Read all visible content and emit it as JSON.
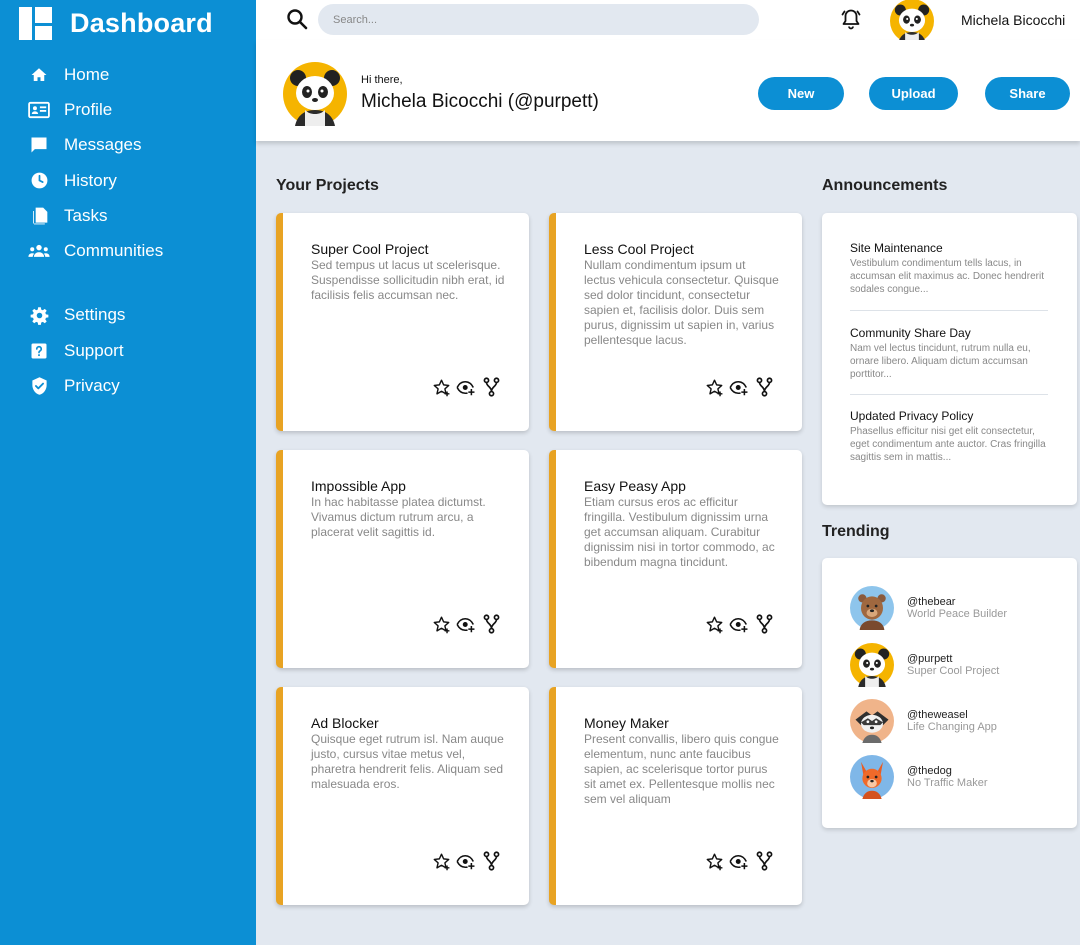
{
  "sidebar": {
    "title": "Dashboard",
    "nav": [
      {
        "label": "Home",
        "icon": "home-icon"
      },
      {
        "label": "Profile",
        "icon": "id-card-icon"
      },
      {
        "label": "Messages",
        "icon": "chat-icon"
      },
      {
        "label": "History",
        "icon": "clock-icon"
      },
      {
        "label": "Tasks",
        "icon": "documents-icon"
      },
      {
        "label": "Communities",
        "icon": "people-icon"
      }
    ],
    "nav2": [
      {
        "label": "Settings",
        "icon": "gear-icon"
      },
      {
        "label": "Support",
        "icon": "help-icon"
      },
      {
        "label": "Privacy",
        "icon": "shield-icon"
      }
    ]
  },
  "topbar": {
    "search_placeholder": "Search...",
    "username": "Michela Bicocchi"
  },
  "header": {
    "greeting": "Hi there,",
    "name": "Michela Bicocchi (@purpett)",
    "buttons": {
      "new": "New",
      "upload": "Upload",
      "share": "Share"
    }
  },
  "projects": {
    "title": "Your Projects",
    "items": [
      {
        "title": "Super Cool Project",
        "desc": "Sed tempus ut lacus ut scelerisque. Suspendisse sollicitudin nibh erat, id facilisis felis accumsan nec."
      },
      {
        "title": "Less Cool Project",
        "desc": "Nullam condimentum ipsum ut lectus vehicula consectetur. Quisque sed dolor tincidunt, consectetur sapien et, facilisis dolor. Duis sem purus, dignissim ut sapien in, varius pellentesque lacus."
      },
      {
        "title": "Impossible App",
        "desc": "In hac habitasse platea dictumst. Vivamus dictum rutrum arcu, a placerat velit sagittis id."
      },
      {
        "title": "Easy Peasy App",
        "desc": "Etiam cursus eros ac efficitur fringilla. Vestibulum dignissim urna get accumsan aliquam. Curabitur dignissim nisi in tortor commodo, ac bibendum magna tincidunt."
      },
      {
        "title": "Ad Blocker",
        "desc": "Quisque eget rutrum isl. Nam auque justo, cursus vitae metus vel, pharetra hendrerit felis. Aliquam sed malesuada eros."
      },
      {
        "title": "Money Maker",
        "desc": "Present convallis, libero quis congue elementum, nunc ante faucibus sapien, ac scelerisque tortor purus sit amet ex. Pellentesque mollis nec sem vel aliquam"
      }
    ]
  },
  "announcements": {
    "title": "Announcements",
    "items": [
      {
        "title": "Site Maintenance",
        "desc": "Vestibulum condimentum tells lacus, in accumsan elit maximus ac. Donec hendrerit sodales congue..."
      },
      {
        "title": "Community Share Day",
        "desc": "Nam vel lectus tincidunt, rutrum nulla eu, ornare libero. Aliquam dictum accumsan porttitor..."
      },
      {
        "title": "Updated Privacy Policy",
        "desc": "Phasellus efficitur nisi get elit consectetur, eget condimentum ante auctor. Cras fringilla sagittis sem in mattis..."
      }
    ]
  },
  "trending": {
    "title": "Trending",
    "items": [
      {
        "handle": "@thebear",
        "sub": "World Peace Builder",
        "avatar": "bear-avatar"
      },
      {
        "handle": "@purpett",
        "sub": "Super Cool Project",
        "avatar": "panda-avatar"
      },
      {
        "handle": "@theweasel",
        "sub": "Life Changing App",
        "avatar": "weasel-avatar"
      },
      {
        "handle": "@thedog",
        "sub": "No Traffic Maker",
        "avatar": "dog-avatar"
      }
    ]
  },
  "colors": {
    "sidebar": "#0c8fd4",
    "accent_bar": "#e8a323",
    "background": "#e2e8f0"
  }
}
